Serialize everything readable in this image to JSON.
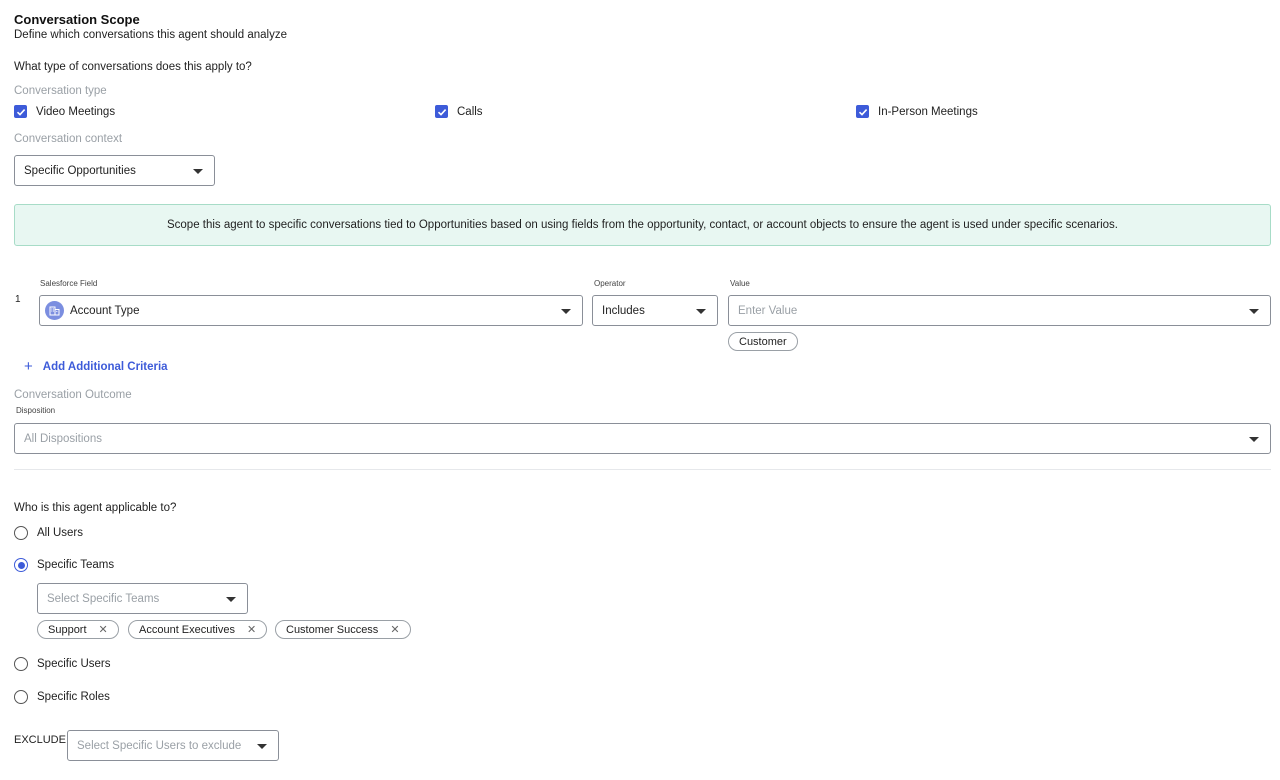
{
  "header": {
    "title": "Conversation Scope",
    "subtitle": "Define which conversations this agent should analyze"
  },
  "conversation_types": {
    "question": "What type of conversations does this apply to?",
    "label": "Conversation type",
    "options": [
      {
        "label": "Video Meetings",
        "checked": true
      },
      {
        "label": "Calls",
        "checked": true
      },
      {
        "label": "In-Person Meetings",
        "checked": true
      }
    ]
  },
  "context": {
    "label": "Conversation context",
    "selected": "Specific Opportunities"
  },
  "banner": {
    "text": "Scope this agent to specific conversations tied to Opportunities based on using fields from the opportunity, contact, or account objects to ensure the agent is used under specific scenarios."
  },
  "criteria": {
    "row_number": "1",
    "field_label": "Salesforce Field",
    "field_value": "Account Type",
    "field_icon": "building-icon",
    "operator_label": "Operator",
    "operator_value": "Includes",
    "value_label": "Value",
    "value_placeholder": "Enter Value",
    "value_chips": [
      "Customer"
    ],
    "add_label": "Add Additional Criteria"
  },
  "outcome": {
    "label": "Conversation Outcome",
    "disposition_label": "Disposition",
    "disposition_placeholder": "All Dispositions"
  },
  "applicability": {
    "question": "Who is this agent applicable to?",
    "options": [
      {
        "label": "All Users",
        "selected": false
      },
      {
        "label": "Specific Teams",
        "selected": true
      },
      {
        "label": "Specific Users",
        "selected": false
      },
      {
        "label": "Specific Roles",
        "selected": false
      }
    ],
    "teams_placeholder": "Select Specific Teams",
    "teams": [
      "Support",
      "Account Executives",
      "Customer Success"
    ]
  },
  "exclude": {
    "label": "EXCLUDE",
    "placeholder": "Select Specific Users to exclude"
  },
  "colors": {
    "accent": "#3d5bd9",
    "banner_bg": "#e8f7f2",
    "banner_border": "#a7dcc7"
  }
}
